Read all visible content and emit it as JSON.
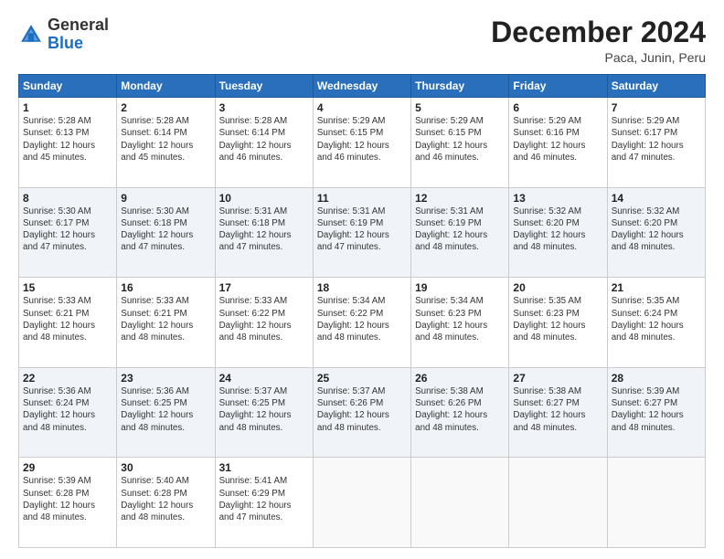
{
  "header": {
    "logo_general": "General",
    "logo_blue": "Blue",
    "month_year": "December 2024",
    "location": "Paca, Junin, Peru"
  },
  "weekdays": [
    "Sunday",
    "Monday",
    "Tuesday",
    "Wednesday",
    "Thursday",
    "Friday",
    "Saturday"
  ],
  "weeks": [
    [
      {
        "day": "1",
        "info": "Sunrise: 5:28 AM\nSunset: 6:13 PM\nDaylight: 12 hours\nand 45 minutes."
      },
      {
        "day": "2",
        "info": "Sunrise: 5:28 AM\nSunset: 6:14 PM\nDaylight: 12 hours\nand 45 minutes."
      },
      {
        "day": "3",
        "info": "Sunrise: 5:28 AM\nSunset: 6:14 PM\nDaylight: 12 hours\nand 46 minutes."
      },
      {
        "day": "4",
        "info": "Sunrise: 5:29 AM\nSunset: 6:15 PM\nDaylight: 12 hours\nand 46 minutes."
      },
      {
        "day": "5",
        "info": "Sunrise: 5:29 AM\nSunset: 6:15 PM\nDaylight: 12 hours\nand 46 minutes."
      },
      {
        "day": "6",
        "info": "Sunrise: 5:29 AM\nSunset: 6:16 PM\nDaylight: 12 hours\nand 46 minutes."
      },
      {
        "day": "7",
        "info": "Sunrise: 5:29 AM\nSunset: 6:17 PM\nDaylight: 12 hours\nand 47 minutes."
      }
    ],
    [
      {
        "day": "8",
        "info": "Sunrise: 5:30 AM\nSunset: 6:17 PM\nDaylight: 12 hours\nand 47 minutes."
      },
      {
        "day": "9",
        "info": "Sunrise: 5:30 AM\nSunset: 6:18 PM\nDaylight: 12 hours\nand 47 minutes."
      },
      {
        "day": "10",
        "info": "Sunrise: 5:31 AM\nSunset: 6:18 PM\nDaylight: 12 hours\nand 47 minutes."
      },
      {
        "day": "11",
        "info": "Sunrise: 5:31 AM\nSunset: 6:19 PM\nDaylight: 12 hours\nand 47 minutes."
      },
      {
        "day": "12",
        "info": "Sunrise: 5:31 AM\nSunset: 6:19 PM\nDaylight: 12 hours\nand 48 minutes."
      },
      {
        "day": "13",
        "info": "Sunrise: 5:32 AM\nSunset: 6:20 PM\nDaylight: 12 hours\nand 48 minutes."
      },
      {
        "day": "14",
        "info": "Sunrise: 5:32 AM\nSunset: 6:20 PM\nDaylight: 12 hours\nand 48 minutes."
      }
    ],
    [
      {
        "day": "15",
        "info": "Sunrise: 5:33 AM\nSunset: 6:21 PM\nDaylight: 12 hours\nand 48 minutes."
      },
      {
        "day": "16",
        "info": "Sunrise: 5:33 AM\nSunset: 6:21 PM\nDaylight: 12 hours\nand 48 minutes."
      },
      {
        "day": "17",
        "info": "Sunrise: 5:33 AM\nSunset: 6:22 PM\nDaylight: 12 hours\nand 48 minutes."
      },
      {
        "day": "18",
        "info": "Sunrise: 5:34 AM\nSunset: 6:22 PM\nDaylight: 12 hours\nand 48 minutes."
      },
      {
        "day": "19",
        "info": "Sunrise: 5:34 AM\nSunset: 6:23 PM\nDaylight: 12 hours\nand 48 minutes."
      },
      {
        "day": "20",
        "info": "Sunrise: 5:35 AM\nSunset: 6:23 PM\nDaylight: 12 hours\nand 48 minutes."
      },
      {
        "day": "21",
        "info": "Sunrise: 5:35 AM\nSunset: 6:24 PM\nDaylight: 12 hours\nand 48 minutes."
      }
    ],
    [
      {
        "day": "22",
        "info": "Sunrise: 5:36 AM\nSunset: 6:24 PM\nDaylight: 12 hours\nand 48 minutes."
      },
      {
        "day": "23",
        "info": "Sunrise: 5:36 AM\nSunset: 6:25 PM\nDaylight: 12 hours\nand 48 minutes."
      },
      {
        "day": "24",
        "info": "Sunrise: 5:37 AM\nSunset: 6:25 PM\nDaylight: 12 hours\nand 48 minutes."
      },
      {
        "day": "25",
        "info": "Sunrise: 5:37 AM\nSunset: 6:26 PM\nDaylight: 12 hours\nand 48 minutes."
      },
      {
        "day": "26",
        "info": "Sunrise: 5:38 AM\nSunset: 6:26 PM\nDaylight: 12 hours\nand 48 minutes."
      },
      {
        "day": "27",
        "info": "Sunrise: 5:38 AM\nSunset: 6:27 PM\nDaylight: 12 hours\nand 48 minutes."
      },
      {
        "day": "28",
        "info": "Sunrise: 5:39 AM\nSunset: 6:27 PM\nDaylight: 12 hours\nand 48 minutes."
      }
    ],
    [
      {
        "day": "29",
        "info": "Sunrise: 5:39 AM\nSunset: 6:28 PM\nDaylight: 12 hours\nand 48 minutes."
      },
      {
        "day": "30",
        "info": "Sunrise: 5:40 AM\nSunset: 6:28 PM\nDaylight: 12 hours\nand 48 minutes."
      },
      {
        "day": "31",
        "info": "Sunrise: 5:41 AM\nSunset: 6:29 PM\nDaylight: 12 hours\nand 47 minutes."
      },
      null,
      null,
      null,
      null
    ]
  ]
}
